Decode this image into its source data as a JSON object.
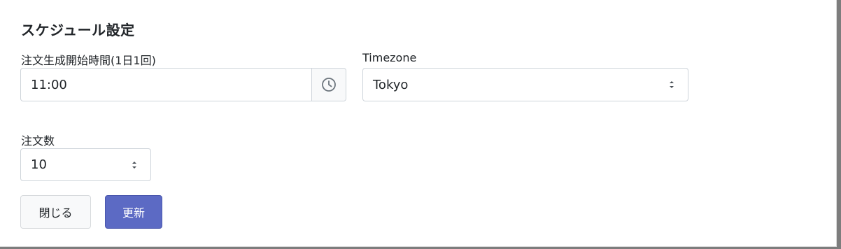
{
  "modal": {
    "title": "スケジュール設定"
  },
  "form": {
    "start_time_label": "注文生成開始時間(1日1回)",
    "start_time_value": "11:00",
    "timezone_label": "Timezone",
    "timezone_value": "Tokyo",
    "quantity_label": "注文数",
    "quantity_value": "10"
  },
  "buttons": {
    "close_label": "閉じる",
    "update_label": "更新"
  },
  "icons": {
    "time_addon": "clock-icon",
    "select_arrows": "chevron-up-down-icon"
  },
  "colors": {
    "primary": "#5c6ac4",
    "border": "#ced4da",
    "text": "#212529",
    "addon_bg": "#f8f9fa"
  }
}
